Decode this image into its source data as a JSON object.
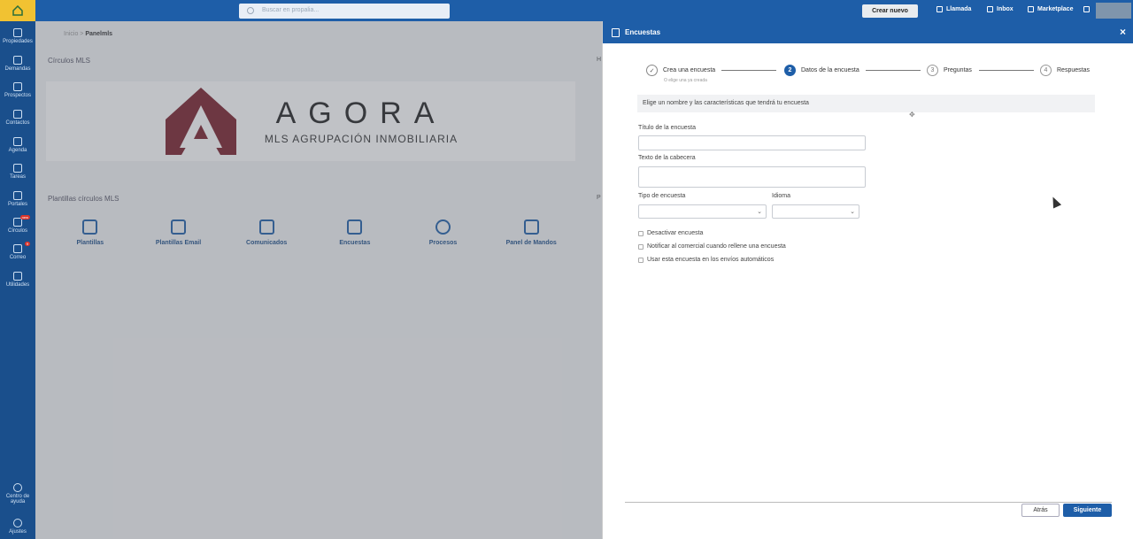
{
  "sidebar": {
    "items": [
      {
        "label": "Propiedades",
        "icon": "home-icon"
      },
      {
        "label": "Demandas",
        "icon": "users-icon"
      },
      {
        "label": "Prospectos",
        "icon": "list-icon"
      },
      {
        "label": "Contactos",
        "icon": "contact-icon"
      },
      {
        "label": "Agenda",
        "icon": "calendar-icon"
      },
      {
        "label": "Tareas",
        "icon": "tasks-icon"
      },
      {
        "label": "Portales",
        "icon": "portals-icon"
      },
      {
        "label": "Círculos",
        "icon": "circles-icon",
        "badge": "new"
      },
      {
        "label": "Correo",
        "icon": "mail-icon",
        "badge": "9"
      },
      {
        "label": "Utilidades",
        "icon": "tools-icon"
      }
    ],
    "help_label": "Centro de ayuda",
    "settings_label": "Ajustes"
  },
  "topbar": {
    "search_placeholder": "Buscar en propalia...",
    "create_button": "Crear nuevo",
    "links": [
      "Llamada",
      "Inbox",
      "Marketplace"
    ]
  },
  "main": {
    "breadcrumb_prefix": "Inicio >",
    "breadcrumb_current": "Panelmls",
    "section_circles": "Círculos MLS",
    "section_templates": "Plantillas círculos MLS",
    "cut_h": "H",
    "cut_p": "P",
    "banner": {
      "name": "AGORA",
      "subtitle": "MLS AGRUPACIÓN INMOBILIARIA",
      "brand_color": "#7a1f2b"
    },
    "tiles": [
      {
        "label": "Plantillas",
        "icon": "templates-icon"
      },
      {
        "label": "Plantillas Email",
        "icon": "email-icon"
      },
      {
        "label": "Comunicados",
        "icon": "announcement-icon"
      },
      {
        "label": "Encuestas",
        "icon": "survey-icon"
      },
      {
        "label": "Procesos",
        "icon": "clock-icon"
      },
      {
        "label": "Panel de Mandos",
        "icon": "dashboard-icon"
      }
    ]
  },
  "panel": {
    "title": "Encuestas",
    "close": "×",
    "steps": [
      {
        "num": "✓",
        "label": "Crea una encuesta",
        "sub": "O elige una ya creada",
        "state": "done"
      },
      {
        "num": "2",
        "label": "Datos de la encuesta",
        "state": "active"
      },
      {
        "num": "3",
        "label": "Preguntas",
        "state": "pending"
      },
      {
        "num": "4",
        "label": "Respuestas",
        "state": "pending"
      }
    ],
    "info": "Elige un nombre y las características que tendrá tu encuesta",
    "fields": {
      "title_label": "Título de la encuesta",
      "title_value": "",
      "header_label": "Texto de la cabecera",
      "header_value": "",
      "type_label": "Tipo de encuesta",
      "type_value": "",
      "language_label": "Idioma",
      "language_value": ""
    },
    "checkboxes": [
      {
        "label": "Desactivar encuesta",
        "checked": false
      },
      {
        "label": "Notificar al comercial cuando rellene una encuesta",
        "checked": false
      },
      {
        "label": "Usar esta encuesta en los envíos automáticos",
        "checked": false
      }
    ],
    "back_button": "Atrás",
    "next_button": "Siguiente",
    "accent_color": "#1e5ea8"
  }
}
